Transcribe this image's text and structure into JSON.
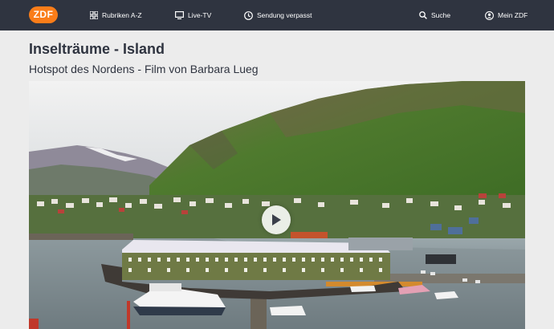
{
  "header": {
    "logo_text": "ZDF",
    "nav": {
      "rubriken": "Rubriken A-Z",
      "livetv": "Live-TV",
      "verpasst": "Sendung verpasst",
      "suche": "Suche",
      "meinzdf": "Mein ZDF"
    },
    "colors": {
      "bar": "#2f3440",
      "logo": "#fa7d19"
    },
    "icons": [
      "grid-icon",
      "tv-icon",
      "clock-icon",
      "search-icon",
      "user-icon"
    ]
  },
  "program": {
    "title": "Inselträume - Island",
    "subtitle": "Hotspot des Nordens - Film von Barbara Lueg"
  },
  "player": {
    "play_icon": "play-icon"
  }
}
